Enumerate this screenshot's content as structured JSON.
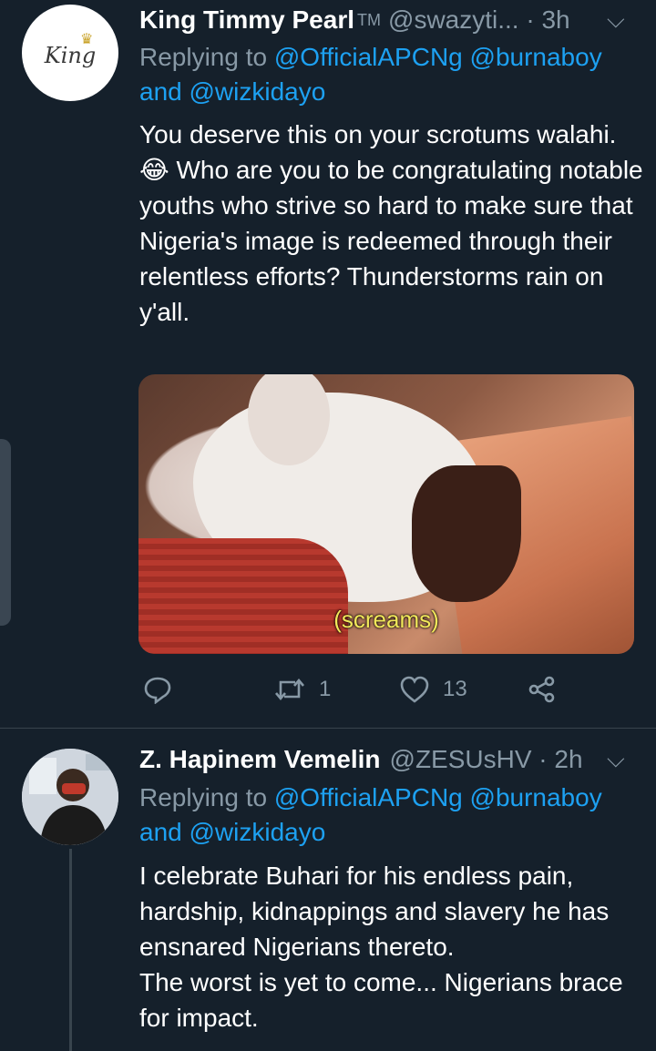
{
  "tweets": [
    {
      "name": "King Timmy Pearl",
      "name_suffix": "TM",
      "handle_time": "@swazyti... · 3h",
      "reply_prefix": "Replying to",
      "reply_mentions": [
        "@OfficialAPCNg",
        "@burnaboy",
        "@wizkidayo"
      ],
      "reply_and": "and",
      "text_before_emoji": "You deserve this on your scrotums walahi.",
      "emoji": "😂",
      "text_after_emoji": " Who are you to be congratulating notable youths who strive so hard to make sure that Nigeria's image is redeemed through their relentless efforts? Thunderstorms rain on y'all.",
      "avatar_text": "King",
      "media_caption": "(screams)",
      "retweet_count": "1",
      "like_count": "13"
    },
    {
      "name": "Z. Hapinem Vemelin",
      "handle_time": "@ZESUsHV · 2h",
      "reply_prefix": "Replying to",
      "reply_mentions": [
        "@OfficialAPCNg",
        "@burnaboy",
        "@wizkidayo"
      ],
      "reply_and": "and",
      "text": "I celebrate Buhari for his endless pain, hardship, kidnappings and slavery he has ensnared Nigerians thereto.\nThe worst is yet to come... Nigerians brace for impact."
    }
  ],
  "icons": {
    "reply": "reply-icon",
    "retweet": "retweet-icon",
    "like": "heart-icon",
    "share": "share-icon",
    "more": "chevron-down-icon"
  },
  "colors": {
    "background": "#15202b",
    "secondary_text": "#8899a6",
    "link": "#1da1f2",
    "divider": "#38444d"
  }
}
